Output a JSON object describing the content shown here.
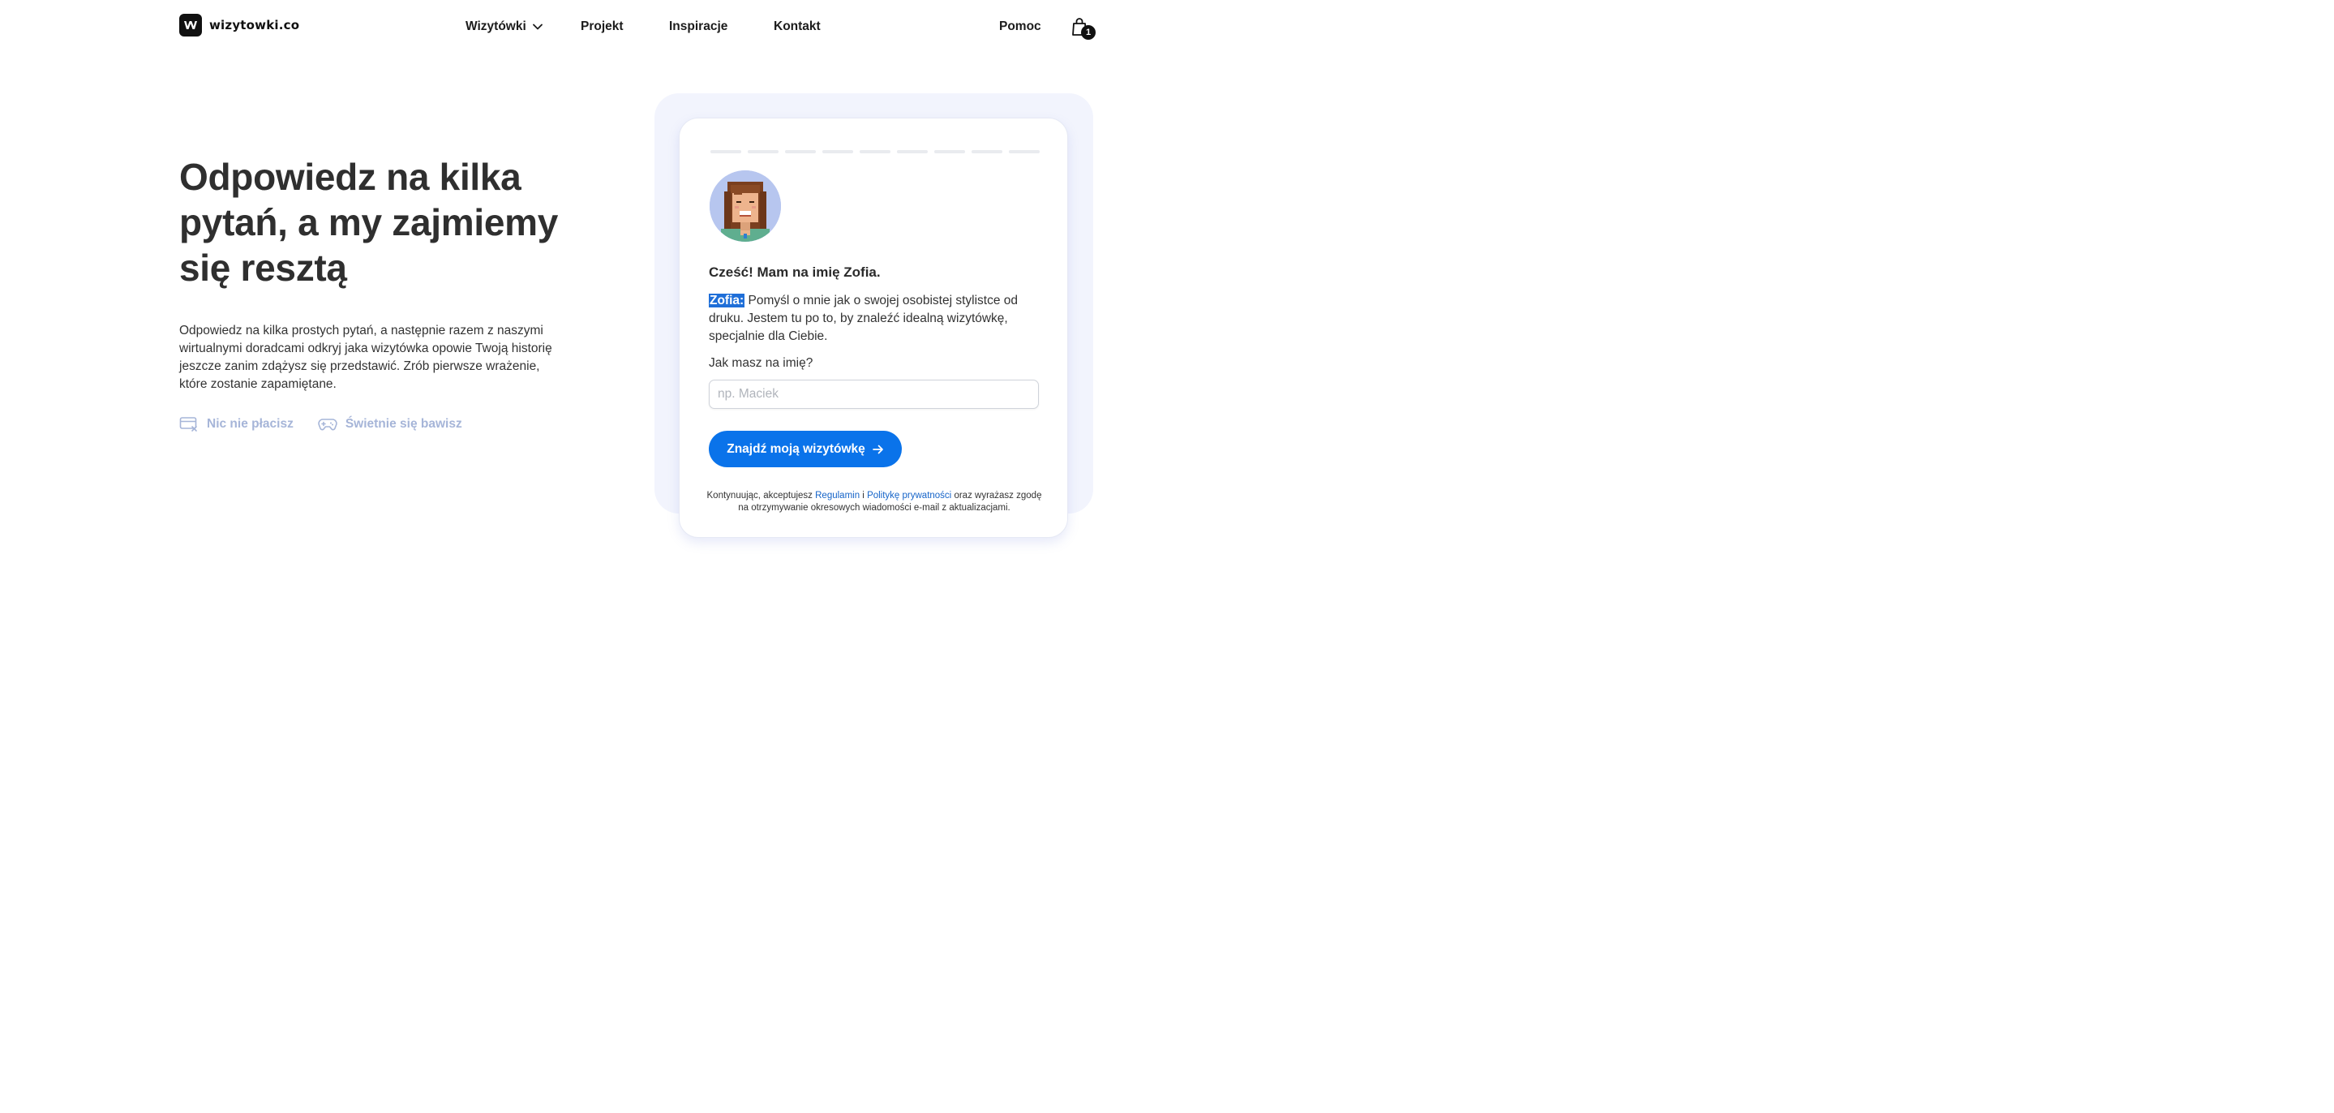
{
  "header": {
    "logo_text": "wizytowki.co",
    "nav": [
      {
        "label": "Wizytówki"
      },
      {
        "label": "Projekt"
      },
      {
        "label": "Inspiracje"
      },
      {
        "label": "Kontakt"
      }
    ],
    "help_label": "Pomoc",
    "cart_count": "1",
    "icons": {
      "logo": "w-logo-icon",
      "dropdown": "chevron-down-icon",
      "cart": "shopping-bag-icon"
    }
  },
  "hero": {
    "title": "Odpowiedz na kilka pytań, a my zajmiemy się resztą",
    "description": "Odpowiedz na kilka prostych pytań, a następnie razem z naszymi wirtualnymi doradcami odkryj jaka wizytówka opowie Twoją historię jeszcze zanim zdążysz się przedstawić. Zrób pierwsze wrażenie, które zostanie zapamiętane.",
    "features": [
      {
        "label": "Nic nie płacisz",
        "icon": "card-x-icon"
      },
      {
        "label": "Świetnie się bawisz",
        "icon": "gamepad-icon"
      }
    ],
    "feature_color": "#a6b5d8"
  },
  "quiz": {
    "progress_segments": 9,
    "greeting": "Cześć! Mam na imię Zofia.",
    "bot_name": "Zofia:",
    "bot_message": " Pomyśl o mnie jak o swojej osobistej stylistce od druku. Jestem tu po to, by znaleźć idealną wizytówkę, specjalnie dla Ciebie.",
    "question": "Jak masz na imię?",
    "input_value": "",
    "input_placeholder": "np. Maciek",
    "submit_label": "Znajdź moją wizytówkę",
    "submit_icon": "arrow-right-icon",
    "legal": {
      "prefix": "Kontynuując, akceptujesz ",
      "terms_link": "Regulamin",
      "and": " i ",
      "privacy_link": "Politykę prywatności",
      "suffix": " oraz wyrażasz zgodę na otrzymywanie okresowych wiadomości e-mail z aktualizacjami."
    },
    "colors": {
      "accent": "#0a73ea",
      "card_bg": "#f2f4fd"
    }
  }
}
